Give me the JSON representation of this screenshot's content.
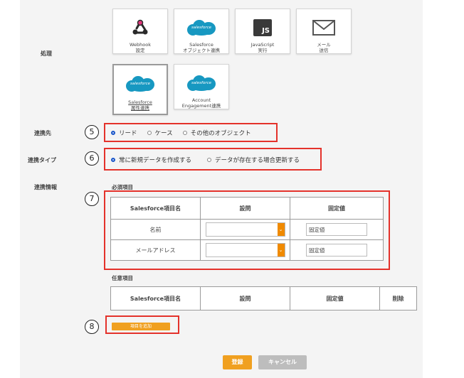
{
  "labels": {
    "process": "処理",
    "destination": "連携先",
    "type": "連携タイプ",
    "info": "連携情報"
  },
  "tiles": [
    {
      "line1": "Webhook",
      "line2": "設定",
      "icon": "webhook-icon"
    },
    {
      "line1": "Salesforce",
      "line2": "オブジェクト連携",
      "icon": "salesforce-icon"
    },
    {
      "line1": "JavaScript",
      "line2": "実行",
      "icon": "javascript-icon"
    },
    {
      "line1": "メール",
      "line2": "送信",
      "icon": "mail-icon"
    },
    {
      "line1": "Salesforce",
      "line2": "属性連携",
      "icon": "salesforce-icon",
      "selected": true
    },
    {
      "line1": "Account",
      "line2": "Engagement連携",
      "icon": "salesforce-icon"
    }
  ],
  "salesforce_logo_text": "salesforce",
  "js_logo_text": "JS",
  "callouts": {
    "n5": "5",
    "n6": "6",
    "n7": "7",
    "n8": "8"
  },
  "destination_options": [
    "リード",
    "ケース",
    "その他のオブジェクト"
  ],
  "destination_selected": "リード",
  "type_options": [
    "常に新規データを作成する",
    "データが存在する場合更新する"
  ],
  "type_selected": "常に新規データを作成する",
  "required": {
    "title": "必須項目",
    "headers": [
      "Salesforce項目名",
      "設問",
      "固定値"
    ],
    "rows": [
      {
        "name": "名前",
        "fixed_placeholder": "固定値"
      },
      {
        "name": "メールアドレス",
        "fixed_placeholder": "固定値"
      }
    ]
  },
  "optional": {
    "title": "任意項目",
    "headers": [
      "Salesforce項目名",
      "設問",
      "固定値",
      "削除"
    ]
  },
  "add_item_label": "項目を追加",
  "register_label": "登録",
  "cancel_label": "キャンセル",
  "colors": {
    "accent": "#f0a020",
    "highlight": "#e4322b",
    "salesforce": "#1798c1",
    "radio": "#1a56c9"
  }
}
